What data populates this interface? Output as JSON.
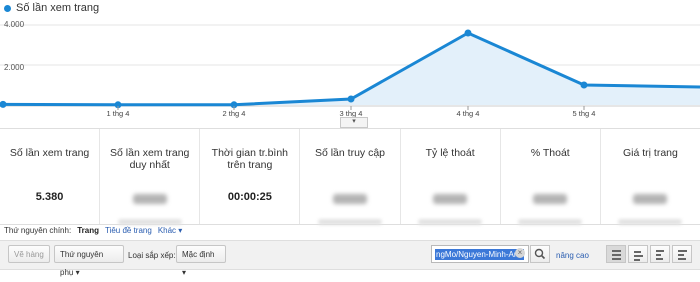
{
  "chart_data": {
    "type": "area",
    "series": [
      {
        "name": "Số lần xem trang",
        "values": [
          30,
          10,
          10,
          300,
          3600,
          1000,
          900
        ]
      }
    ],
    "x_tick_labels": [
      "1 thg 4",
      "2 thg 4",
      "3 thg 4",
      "4 thg 4",
      "5 thg 4"
    ],
    "y_tick_labels": [
      "4.000",
      "2.000"
    ],
    "ylim": [
      0,
      4000
    ],
    "color": "#1a87d4"
  },
  "stats": [
    {
      "label": "Số lần xem trang",
      "value": "5.380"
    },
    {
      "label": "Số lần xem trang duy nhất",
      "value": null
    },
    {
      "label": "Thời gian tr.bình trên trang",
      "value": "00:00:25"
    },
    {
      "label": "Số lần truy cập",
      "value": null
    },
    {
      "label": "Tỷ lệ thoát",
      "value": null
    },
    {
      "label": "% Thoát",
      "value": null
    },
    {
      "label": "Giá trị trang",
      "value": null
    }
  ],
  "dimension_row": {
    "label": "Thứ nguyên chính:",
    "active": "Trang",
    "link1": "Tiêu đề trang",
    "link2": "Khác",
    "caret": "▾"
  },
  "toolbar": {
    "plot_button": "Vẽ hàng",
    "secondary_dim": "Thứ nguyên phụ",
    "sort_label": "Loại sắp xếp:",
    "sort_value": "Mặc định",
    "search_value": "ngMo/Nguyen-Minh-Anh",
    "clear_glyph": "×",
    "advanced": "nâng cao",
    "caret": "▾"
  },
  "collapse_glyph": "▾"
}
